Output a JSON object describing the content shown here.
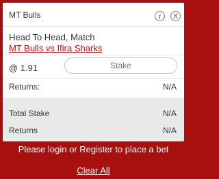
{
  "betslip": {
    "selection": "MT Bulls",
    "market": "Head To Head, Match",
    "event": "MT Bulls vs Ifira Sharks",
    "odds": "@ 1.91",
    "stake_placeholder": "Stake",
    "returns_label": "Returns:",
    "returns_value": "N/A",
    "info_icon": "info-icon",
    "close_icon": "close-icon"
  },
  "summary": {
    "total_stake_label": "Total Stake",
    "total_stake_value": "N/A",
    "returns_label": "Returns",
    "returns_value": "N/A"
  },
  "footer": {
    "login_text": "Please login or Register to place a bet",
    "clear_all": "Clear All"
  },
  "colors": {
    "accent": "#a80f0f",
    "link": "#b30e0e"
  }
}
